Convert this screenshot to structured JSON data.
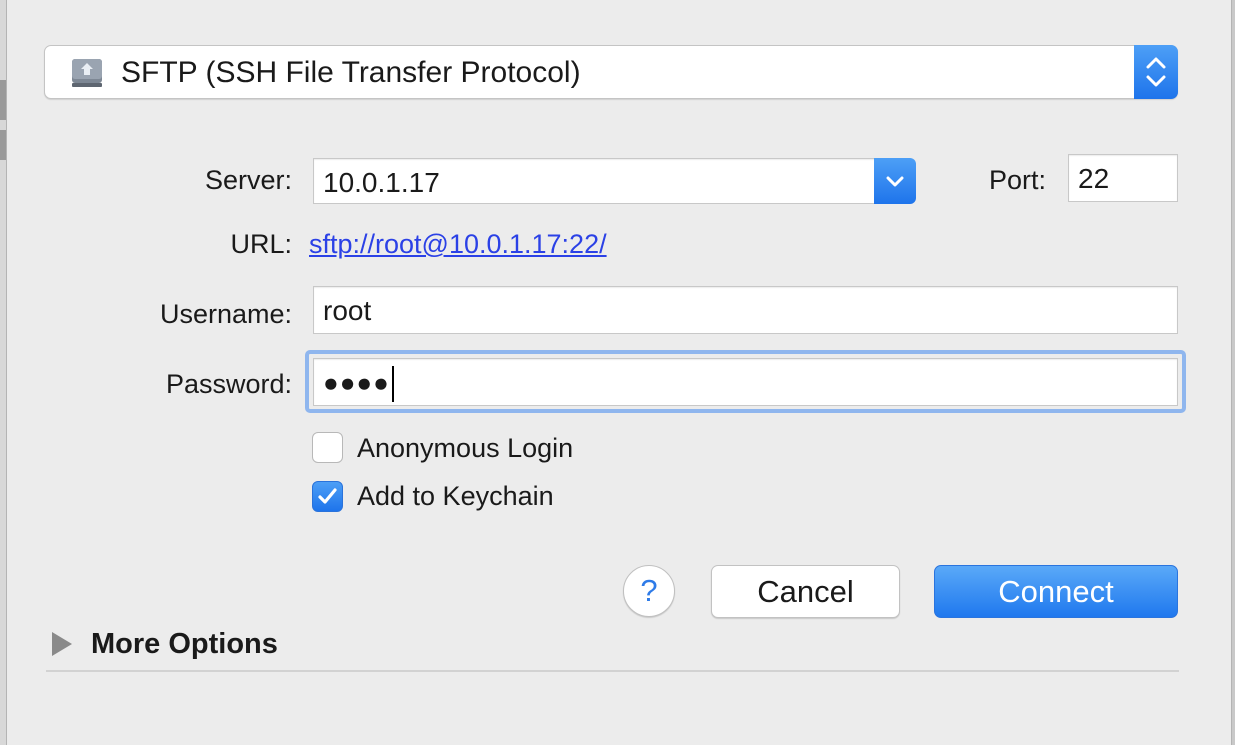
{
  "protocol": {
    "label": "SFTP (SSH File Transfer Protocol)",
    "icon": "network-disk-icon"
  },
  "server": {
    "label": "Server:",
    "value": "10.0.1.17"
  },
  "port": {
    "label": "Port:",
    "value": "22"
  },
  "url": {
    "label": "URL:",
    "value": "sftp://root@10.0.1.17:22/"
  },
  "username": {
    "label": "Username:",
    "value": "root"
  },
  "password": {
    "label": "Password:",
    "masked_value": "●●●●"
  },
  "options": {
    "anonymous": {
      "label": "Anonymous Login",
      "checked": false
    },
    "keychain": {
      "label": "Add to Keychain",
      "checked": true
    }
  },
  "buttons": {
    "help": "?",
    "cancel": "Cancel",
    "connect": "Connect"
  },
  "more_options": {
    "label": "More Options"
  },
  "colors": {
    "accent": "#1e74eb",
    "link": "#2b41e6",
    "focus": "#8fb6ee",
    "background": "#ececec"
  }
}
